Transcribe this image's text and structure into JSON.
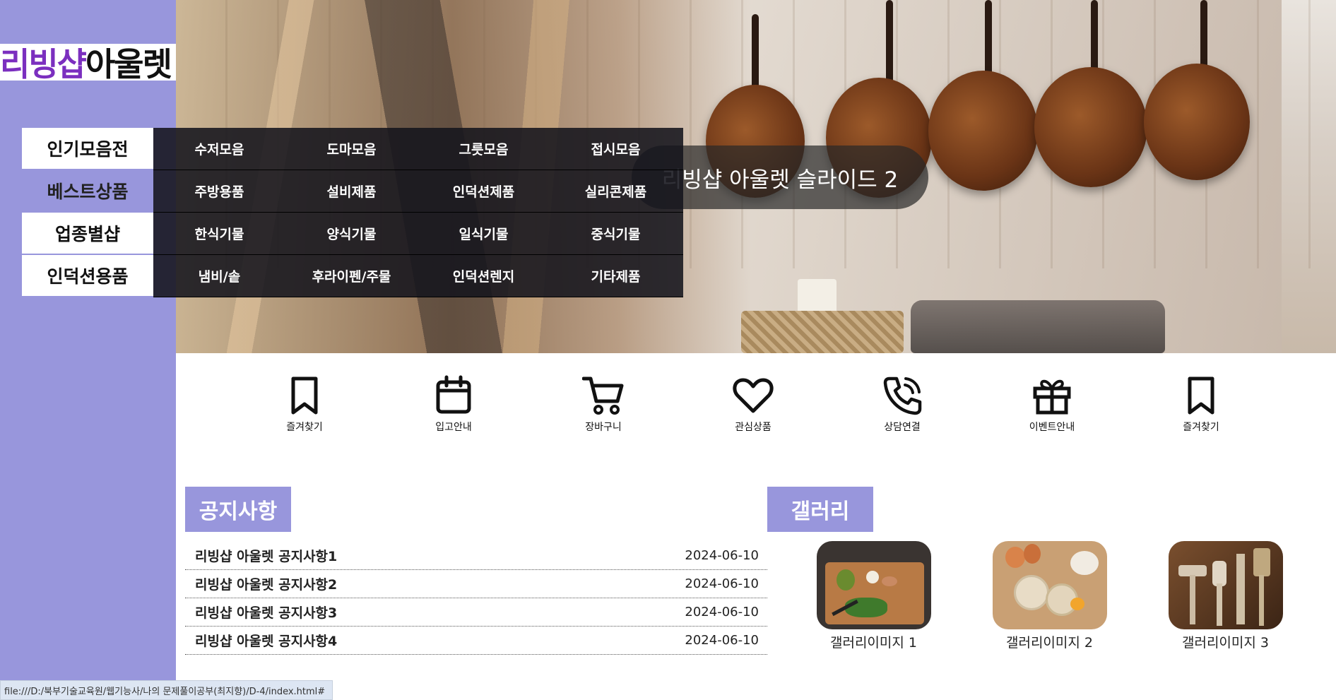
{
  "logo": {
    "part1": "리빙샵",
    "part2": "아울렛"
  },
  "menu": [
    {
      "label": "인기모음전",
      "active": false,
      "subs": [
        "수저모음",
        "도마모음",
        "그릇모음",
        "접시모음"
      ]
    },
    {
      "label": "베스트상품",
      "active": true,
      "subs": [
        "주방용품",
        "설비제품",
        "인덕션제품",
        "실리콘제품"
      ]
    },
    {
      "label": "업종별샵",
      "active": false,
      "subs": [
        "한식기물",
        "양식기물",
        "일식기물",
        "중식기물"
      ]
    },
    {
      "label": "인덕션용품",
      "active": false,
      "subs": [
        "냄비/솥",
        "후라이펜/주물",
        "인덕션렌지",
        "기타제품"
      ]
    }
  ],
  "slide": {
    "caption": "리빙샵 아울렛 슬라이드 2"
  },
  "quick_links": [
    {
      "label": "즐겨찾기",
      "icon": "bookmark-icon"
    },
    {
      "label": "입고안내",
      "icon": "calendar-icon"
    },
    {
      "label": "장바구니",
      "icon": "cart-icon"
    },
    {
      "label": "관심상품",
      "icon": "heart-icon"
    },
    {
      "label": "상담연결",
      "icon": "phone-icon"
    },
    {
      "label": "이벤트안내",
      "icon": "gift-icon"
    },
    {
      "label": "즐겨찾기",
      "icon": "bookmark-icon"
    }
  ],
  "notice": {
    "title": "공지사항",
    "items": [
      {
        "title": "리빙샵 아울렛 공지사항1",
        "date": "2024-06-10"
      },
      {
        "title": "리빙샵 아울렛 공지사항2",
        "date": "2024-06-10"
      },
      {
        "title": "리빙샵 아울렛 공지사항3",
        "date": "2024-06-10"
      },
      {
        "title": "리빙샵 아울렛 공지사항4",
        "date": "2024-06-10"
      }
    ]
  },
  "gallery": {
    "title": "갤러리",
    "items": [
      {
        "label": "갤러리이미지 1"
      },
      {
        "label": "갤러리이미지 2"
      },
      {
        "label": "갤러리이미지 3"
      }
    ]
  },
  "statusbar": {
    "url": "file:///D:/북부기술교육원/웹기능사/나의 문제풀이공부(최지향)/D-4/index.html#"
  },
  "colors": {
    "accent": "#9896dc",
    "menu_panel": "#14141c",
    "logo_purple": "#7b2fbf"
  }
}
